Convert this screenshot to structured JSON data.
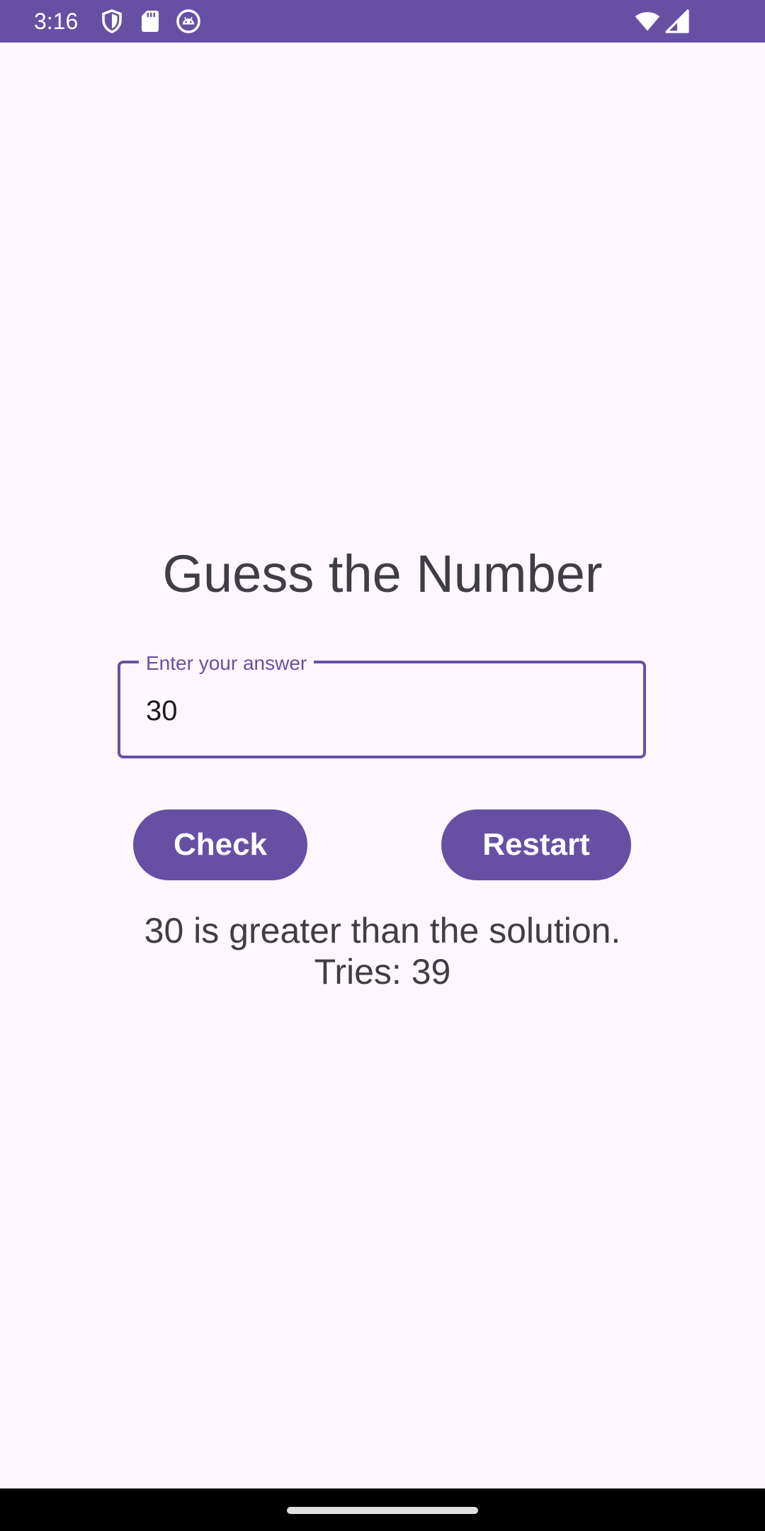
{
  "status_bar": {
    "time": "3:16",
    "background_color": "#6750A4",
    "left_icons": [
      "shield-icon",
      "sd-card-icon",
      "android-robot-icon"
    ],
    "right_icons": [
      "wifi-icon",
      "cell-signal-icon"
    ]
  },
  "app": {
    "title": "Guess the Number",
    "accent_color": "#6750A4",
    "background_color": "#FFF7FE"
  },
  "answer_field": {
    "label": "Enter your answer",
    "value": "30"
  },
  "buttons": {
    "check_label": "Check",
    "restart_label": "Restart"
  },
  "result": {
    "message": "30 is greater than the solution.",
    "tries": "Tries: 39"
  },
  "nav_bar": {
    "background_color": "#000000",
    "handle": "gesture-handle"
  }
}
